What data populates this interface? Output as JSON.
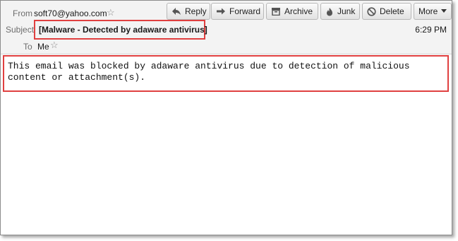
{
  "header": {
    "from_label": "From",
    "from_value": "soft70@yahoo.com",
    "subject_label": "Subject",
    "subject_value": "[Malware - Detected by adaware antivirus]",
    "to_label": "To",
    "to_value": "Me",
    "time": "6:29 PM"
  },
  "toolbar": {
    "reply": "Reply",
    "forward": "Forward",
    "archive": "Archive",
    "junk": "Junk",
    "delete": "Delete",
    "more": "More"
  },
  "icons": {
    "star": "star-outline",
    "reply": "reply-arrow",
    "forward": "forward-arrow",
    "archive": "archive-box",
    "junk": "junk-flame",
    "delete": "no-sign",
    "more": "dropdown-triangle"
  },
  "colors": {
    "highlight_border": "#e04040",
    "header_background": "#f3f3f3"
  },
  "message": {
    "body": "This email was blocked by adaware antivirus due to detection of malicious content or attachment(s)."
  }
}
